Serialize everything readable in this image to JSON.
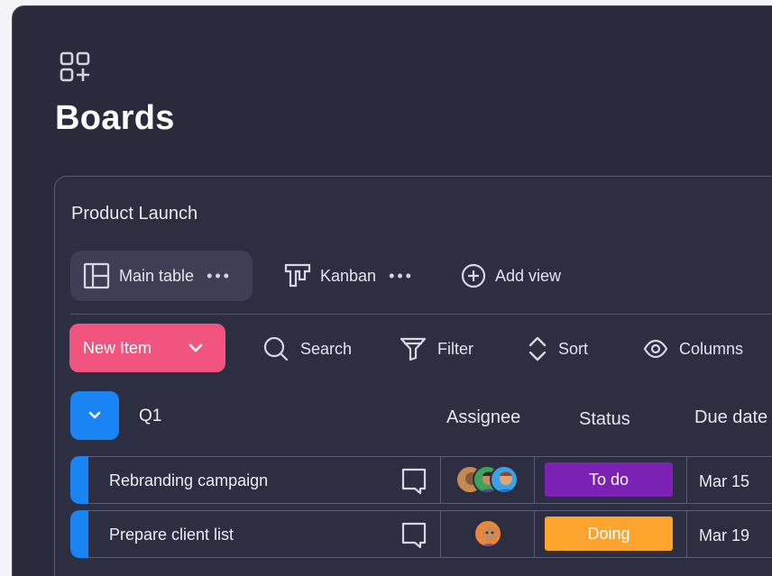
{
  "page": {
    "title": "Boards",
    "icon": "grid-add-icon"
  },
  "board": {
    "name": "Product Launch",
    "views": [
      {
        "label": "Main table",
        "icon": "table-layout-icon",
        "menu": "•••",
        "active": true
      },
      {
        "label": "Kanban",
        "icon": "kanban-icon",
        "menu": "•••",
        "active": false
      },
      {
        "label": "Add view",
        "icon": "plus-circle-icon"
      }
    ],
    "toolbar": {
      "new_item_label": "New Item",
      "search_label": "Search",
      "filter_label": "Filter",
      "sort_label": "Sort",
      "columns_label": "Columns"
    },
    "group": {
      "name": "Q1",
      "columns": {
        "assignee": "Assignee",
        "status": "Status",
        "due_date": "Due date"
      },
      "rows": [
        {
          "task": "Rebranding campaign",
          "assignees": 3,
          "status": "To do",
          "status_color": "#7b22b4",
          "due": "Mar 15"
        },
        {
          "task": "Prepare client list",
          "assignees": 1,
          "status": "Doing",
          "status_color": "#fda42e",
          "due": "Mar 19"
        }
      ]
    }
  },
  "colors": {
    "accent_blue": "#1b84f5",
    "new_item_pink": "#f0547f",
    "background": "#292a3b"
  }
}
